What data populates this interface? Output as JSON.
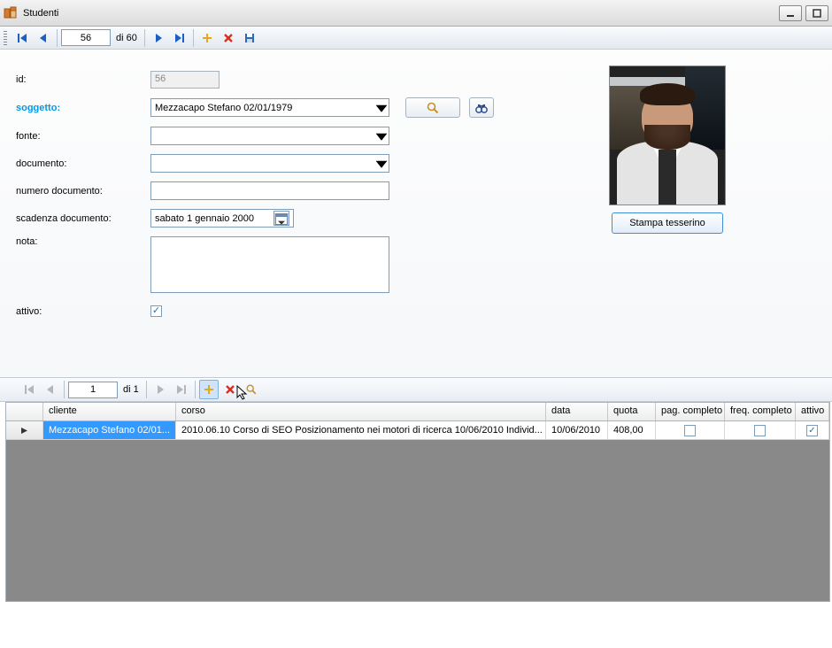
{
  "window": {
    "title": "Studenti"
  },
  "nav_top": {
    "current": "56",
    "of_label": "di 60"
  },
  "form": {
    "labels": {
      "id": "id:",
      "soggetto": "soggetto:",
      "fonte": "fonte:",
      "documento": "documento:",
      "numero_documento": "numero documento:",
      "scadenza_documento": "scadenza documento:",
      "nota": "nota:",
      "attivo": "attivo:"
    },
    "id": "56",
    "soggetto": "Mezzacapo Stefano 02/01/1979",
    "fonte": "",
    "documento": "",
    "numero_documento": "",
    "scadenza_documento": "sabato    1  gennaio   2000",
    "nota": "",
    "attivo_checked": true,
    "stampa_tesserino": "Stampa tesserino"
  },
  "nav_sub": {
    "current": "1",
    "of_label": "di 1"
  },
  "grid": {
    "headers": {
      "cliente": "cliente",
      "corso": "corso",
      "data": "data",
      "quota": "quota",
      "pag_completo": "pag. completo",
      "freq_completo": "freq. completo",
      "attivo": "attivo"
    },
    "rows": [
      {
        "cliente": "Mezzacapo Stefano 02/01...",
        "corso": "2010.06.10 Corso di SEO Posizionamento nei motori di ricerca 10/06/2010 Individ...",
        "data": "10/06/2010",
        "quota": "408,00",
        "pag_completo": false,
        "freq_completo": false,
        "attivo": true
      }
    ]
  }
}
